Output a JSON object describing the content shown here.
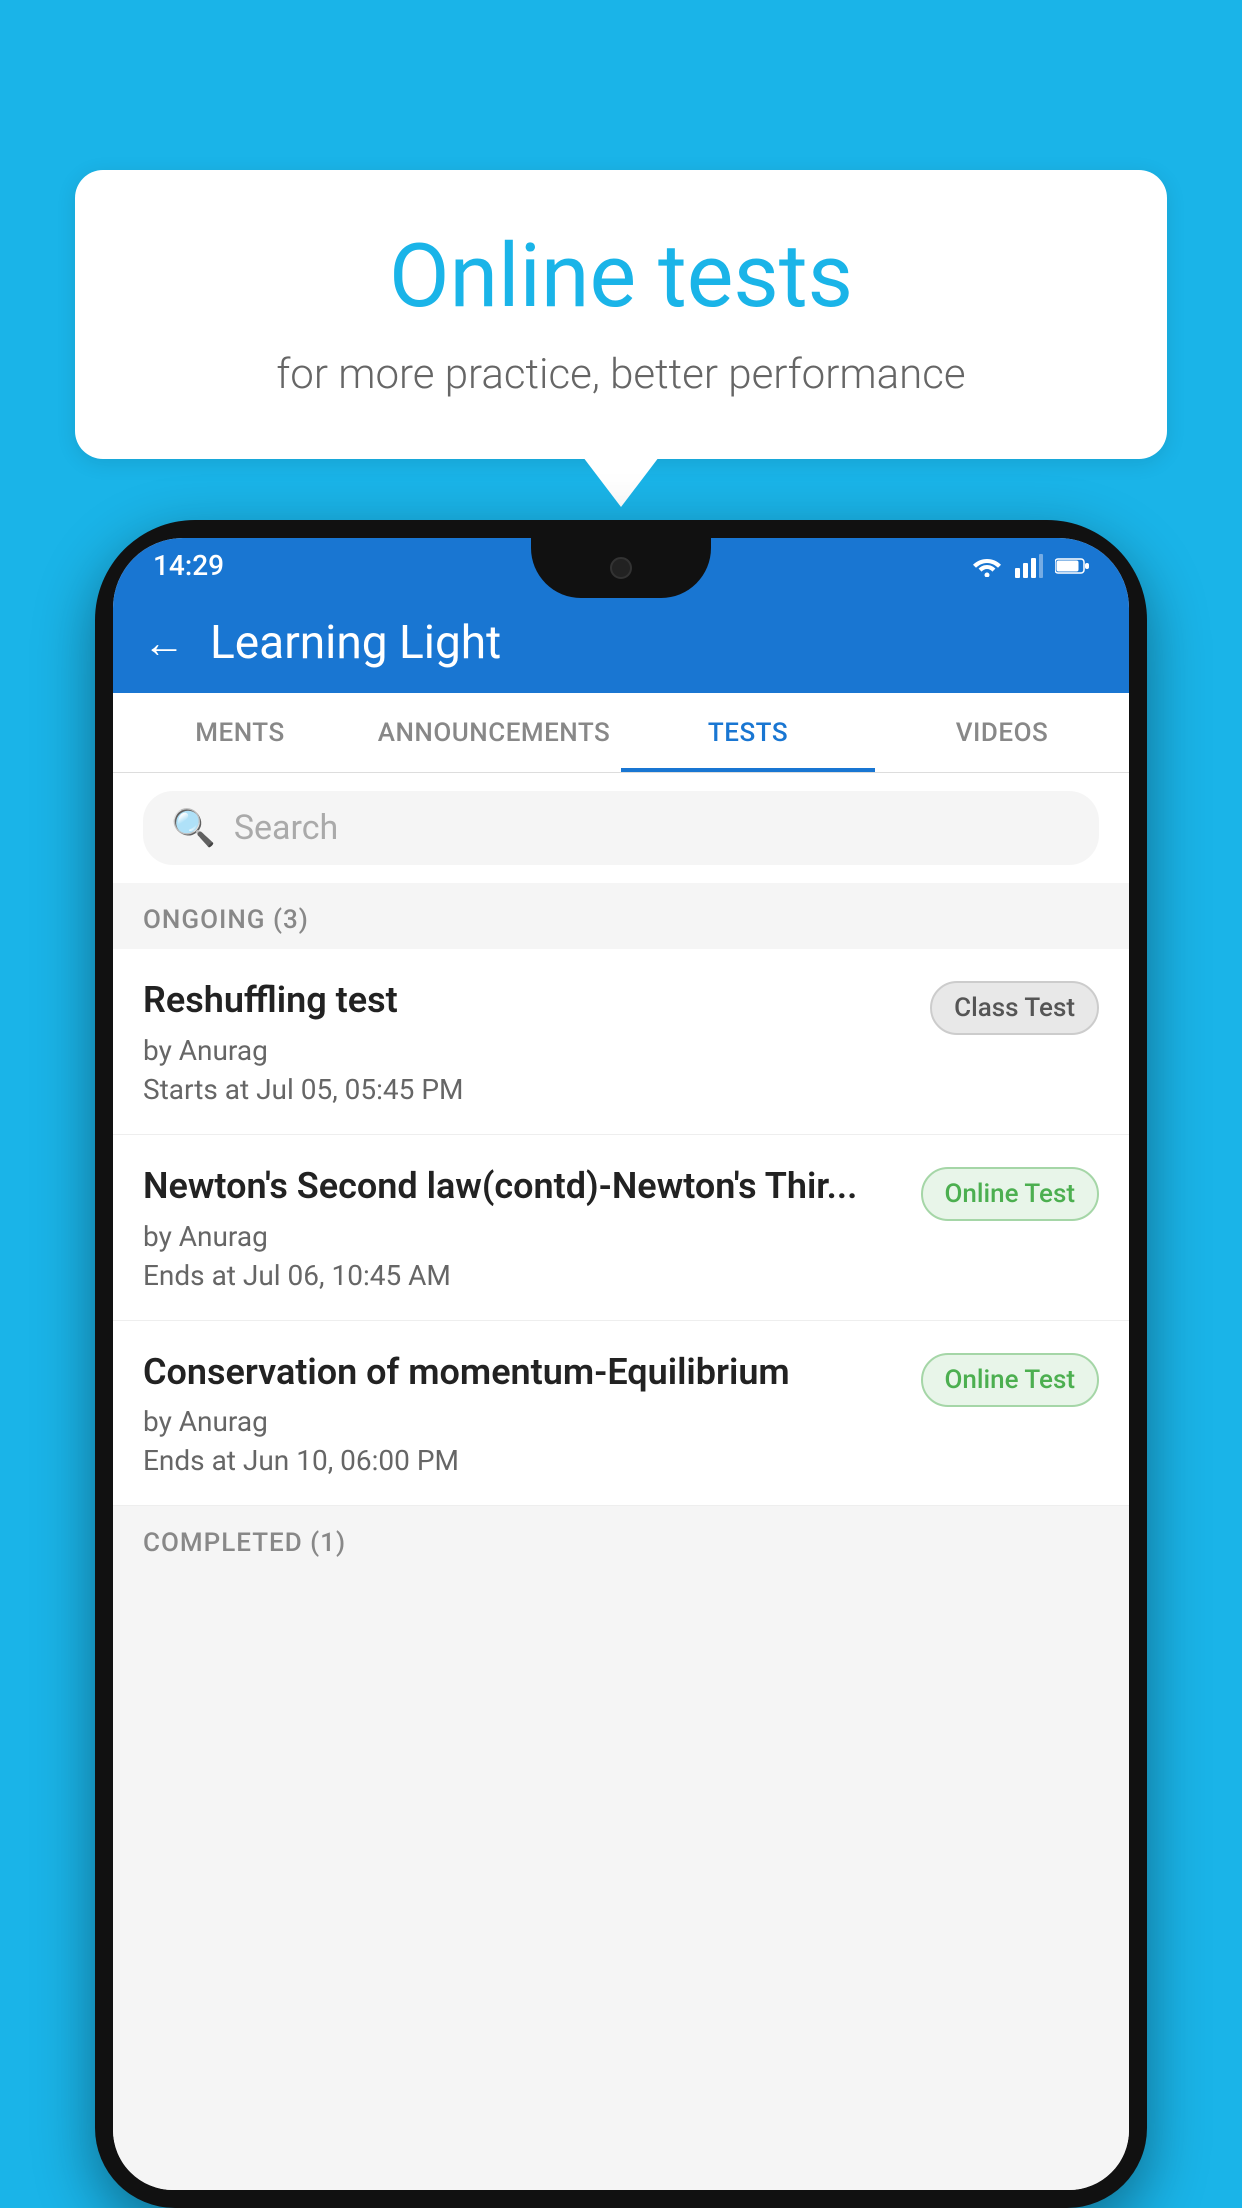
{
  "background": {
    "color": "#1ab4e8"
  },
  "speech_bubble": {
    "title": "Online tests",
    "subtitle": "for more practice, better performance"
  },
  "phone": {
    "status_bar": {
      "time": "14:29",
      "icons": [
        "wifi",
        "signal",
        "battery"
      ]
    },
    "app_header": {
      "back_label": "←",
      "title": "Learning Light"
    },
    "tabs": [
      {
        "label": "MENTS",
        "active": false
      },
      {
        "label": "ANNOUNCEMENTS",
        "active": false
      },
      {
        "label": "TESTS",
        "active": true
      },
      {
        "label": "VIDEOS",
        "active": false
      }
    ],
    "search": {
      "placeholder": "Search"
    },
    "section_ongoing": {
      "title": "ONGOING (3)"
    },
    "tests": [
      {
        "name": "Reshuffling test",
        "author": "by Anurag",
        "time_label": "Starts at",
        "time": "Jul 05, 05:45 PM",
        "badge": "Class Test",
        "badge_type": "class"
      },
      {
        "name": "Newton's Second law(contd)-Newton's Thir...",
        "author": "by Anurag",
        "time_label": "Ends at",
        "time": "Jul 06, 10:45 AM",
        "badge": "Online Test",
        "badge_type": "online"
      },
      {
        "name": "Conservation of momentum-Equilibrium",
        "author": "by Anurag",
        "time_label": "Ends at",
        "time": "Jun 10, 06:00 PM",
        "badge": "Online Test",
        "badge_type": "online"
      }
    ],
    "section_completed": {
      "title": "COMPLETED (1)"
    }
  }
}
